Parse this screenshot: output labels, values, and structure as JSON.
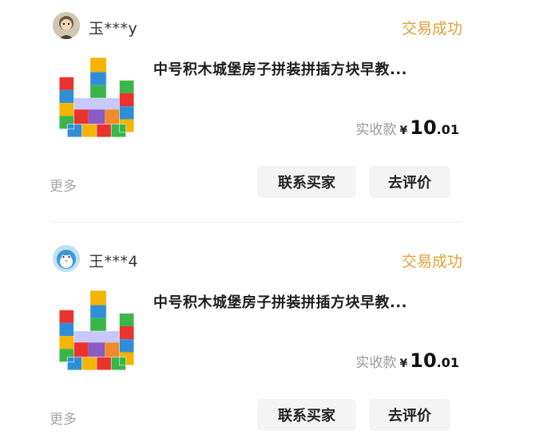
{
  "orders": [
    {
      "buyer_name": "玉***y",
      "status": "交易成功",
      "product_title": "中号积木城堡房子拼装拼插方块早教...",
      "price_label": "实收款",
      "currency": "¥",
      "price_int": "10",
      "price_dec": ".01",
      "more_label": "更多",
      "contact_label": "联系买家",
      "review_label": "去评价"
    },
    {
      "buyer_name": "王***4",
      "status": "交易成功",
      "product_title": "中号积木城堡房子拼装拼插方块早教...",
      "price_label": "实收款",
      "currency": "¥",
      "price_int": "10",
      "price_dec": ".01",
      "more_label": "更多",
      "contact_label": "联系买家",
      "review_label": "去评价"
    }
  ],
  "colors": {
    "status": "#e0a23b",
    "button_bg": "#f4f4f4",
    "muted_text": "#a8a8a8"
  },
  "icons": {
    "avatar_1": "cartoon-avatar-icon",
    "avatar_2": "penguin-avatar-icon",
    "product": "building-blocks-castle-image"
  }
}
